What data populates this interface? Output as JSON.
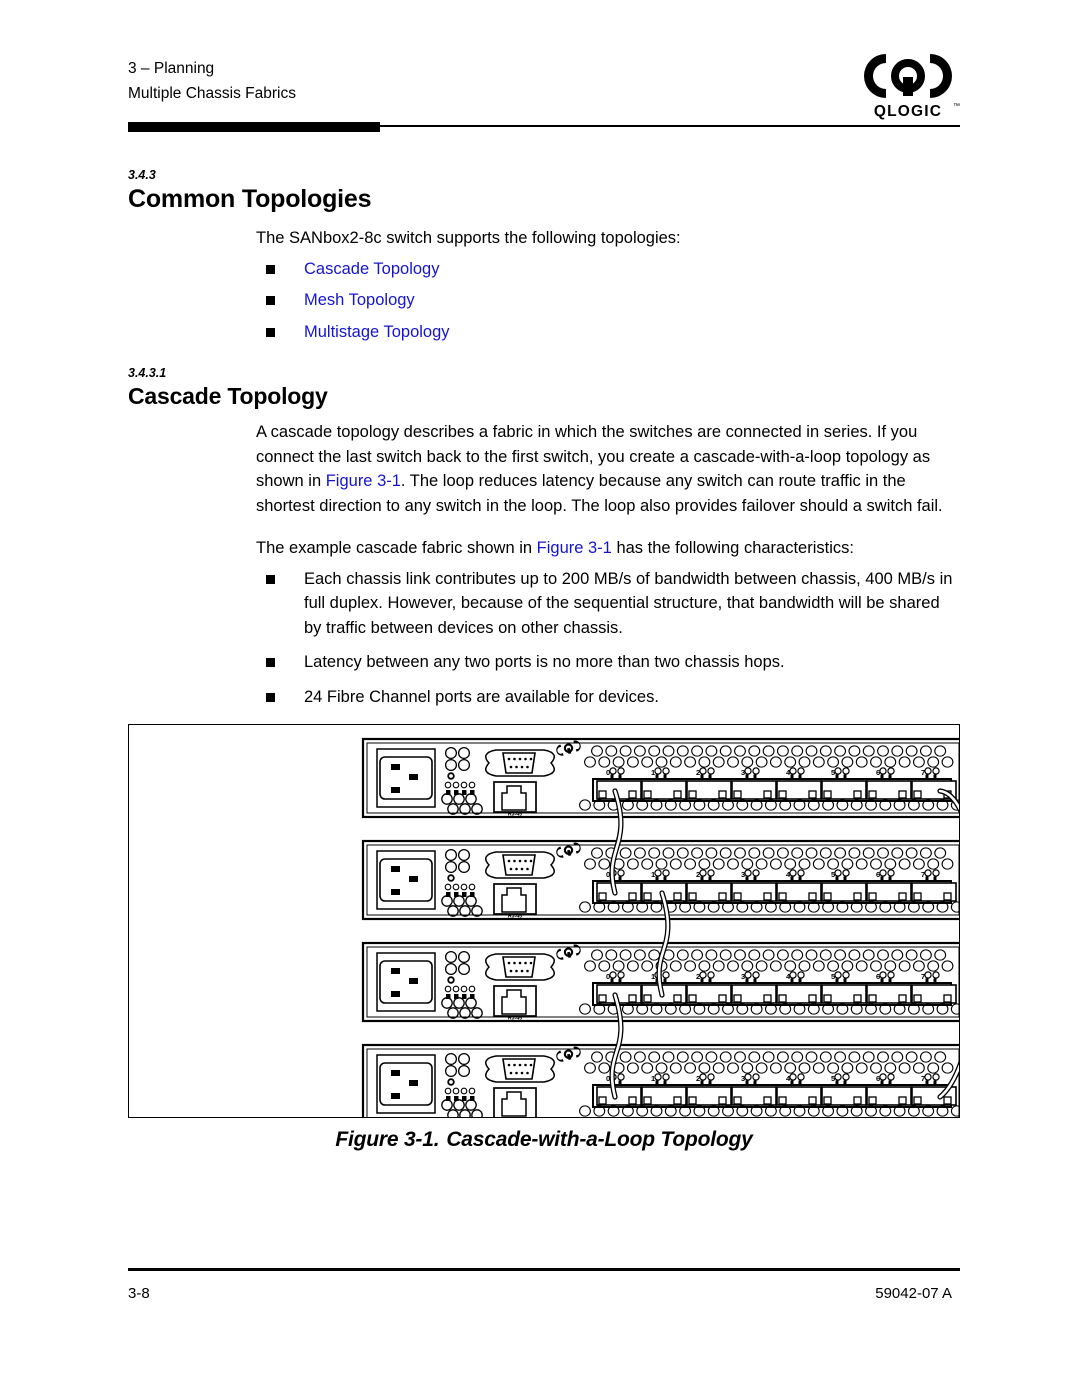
{
  "header": {
    "chapter": "3 – Planning",
    "section": "Multiple Chassis Fabrics",
    "logo_text": "QLOGIC",
    "logo_tm": "™"
  },
  "section1": {
    "number": "3.4.3",
    "title": "Common Topologies",
    "intro": "The SANbox2-8c switch supports the following topologies:",
    "links": [
      "Cascade Topology",
      "Mesh Topology",
      "Multistage Topology"
    ]
  },
  "section2": {
    "number": "3.4.3.1",
    "title": "Cascade Topology",
    "para1_a": "A cascade topology describes a fabric in which the switches are connected in series. If you connect the last switch back to the first switch, you create a cascade-with-a-loop topology as shown in ",
    "para1_link": "Figure 3-1",
    "para1_b": ". The loop reduces latency because any switch can route traffic in the shortest direction to any switch in the loop. The loop also provides failover should a switch fail.",
    "para2_a": "The example cascade fabric shown in ",
    "para2_link": "Figure 3-1",
    "para2_b": " has the following characteristics:",
    "characteristics": [
      "Each chassis link contributes up to 200 MB/s of bandwidth between chassis, 400 MB/s in full duplex. However, because of the sequential structure, that bandwidth will be shared by traffic between devices on other chassis.",
      "Latency between any two ports is no more than two chassis hops.",
      "24 Fibre Channel ports are available for devices."
    ]
  },
  "figure": {
    "caption_number": "Figure 3-1.",
    "caption_title": "Cascade-with-a-Loop Topology",
    "switch_count": 4,
    "port_labels": [
      "0",
      "1",
      "2",
      "3",
      "4",
      "5",
      "6",
      "7"
    ],
    "ethernet_label": "RJ-45",
    "connections": [
      "switch1-port0 to switch2-port0",
      "switch2-port1 to switch3-port1",
      "switch3-port0 to switch4-port0",
      "switch1-port7 to switch4-port7"
    ]
  },
  "footer": {
    "page_number": "3-8",
    "document_number": "59042-07  A"
  }
}
